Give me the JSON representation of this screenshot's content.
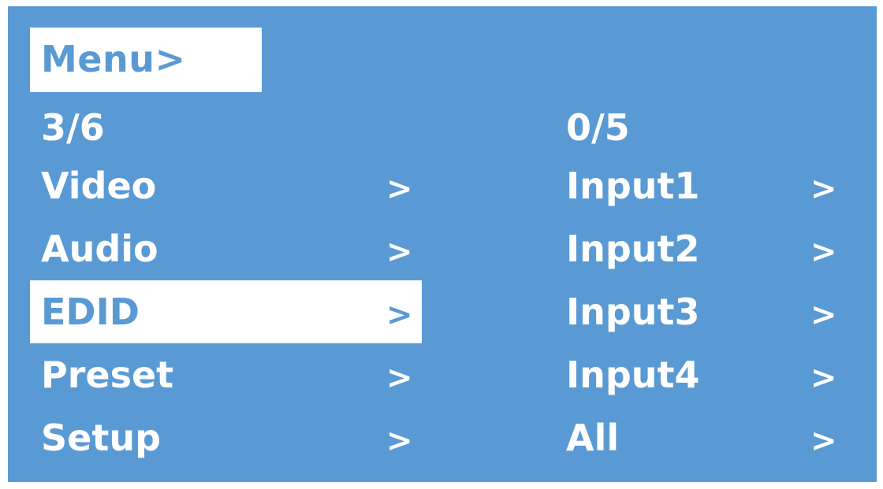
{
  "title": "Menu>",
  "left_panel": {
    "position": "3/6",
    "items": [
      {
        "label": "Video",
        "arrow": ">",
        "selected": false
      },
      {
        "label": "Audio",
        "arrow": ">",
        "selected": false
      },
      {
        "label": "EDID",
        "arrow": ">",
        "selected": true
      },
      {
        "label": "Preset",
        "arrow": ">",
        "selected": false
      },
      {
        "label": "Setup",
        "arrow": ">",
        "selected": false
      }
    ]
  },
  "right_panel": {
    "position": "0/5",
    "items": [
      {
        "label": "Input1",
        "arrow": ">"
      },
      {
        "label": "Input2",
        "arrow": ">"
      },
      {
        "label": "Input3",
        "arrow": ">"
      },
      {
        "label": "Input4",
        "arrow": ">"
      },
      {
        "label": "All",
        "arrow": ">"
      }
    ]
  },
  "colors": {
    "background": "#5a9ad4",
    "highlight": "#ffffff",
    "text": "#ffffff"
  }
}
